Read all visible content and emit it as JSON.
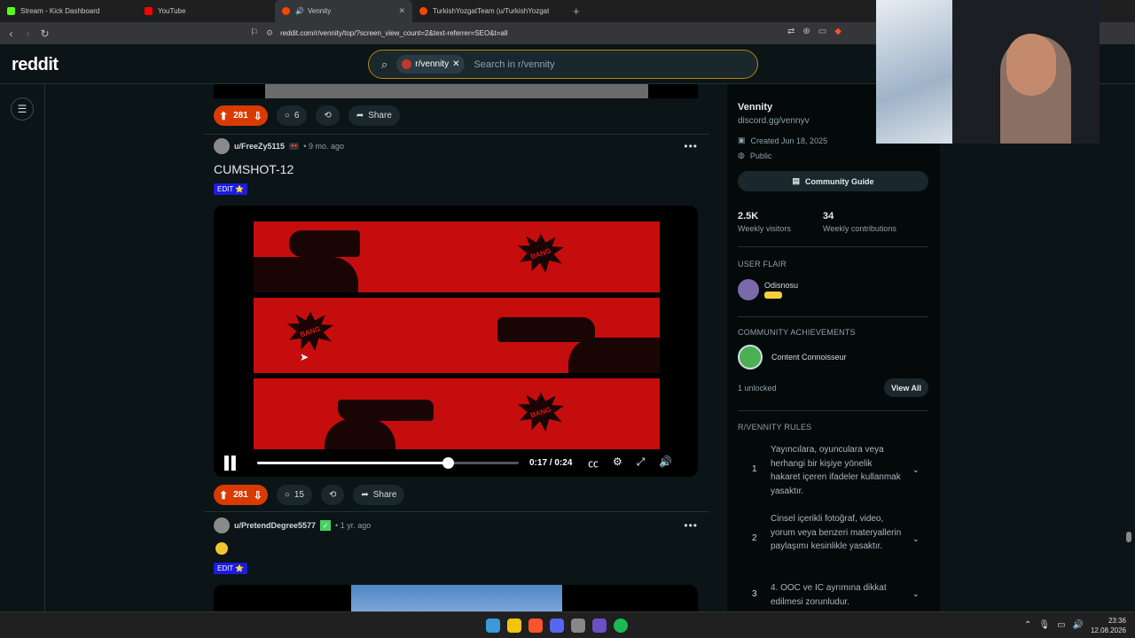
{
  "browser": {
    "tabs": [
      {
        "label": "Stream - Kick Dashboard",
        "color": "#53fc18",
        "active": false
      },
      {
        "label": "YouTube",
        "color": "#ff0000",
        "active": false
      },
      {
        "label": "Vennity",
        "color": "#ff4500",
        "active": true,
        "muted_icon": "speaker-icon"
      },
      {
        "label": "TurkishYozgatTeam (u/TurkishYozgat",
        "color": "#ff4500",
        "active": false
      }
    ],
    "url": "reddit.com/r/vennity/top/?screen_view_count=2&text-referrer=SEO&t=all"
  },
  "header": {
    "logo": "reddit",
    "search_chip": "r/vennity",
    "search_placeholder": "Search in r/vennity"
  },
  "posts": [
    {
      "votes": "281",
      "comments": "6",
      "share": "Share"
    },
    {
      "author": "u/FreeZy5115",
      "time": "• 9 mo. ago",
      "title": "CUMSHOT-12",
      "flair": "EDIT ⭐",
      "video": {
        "current": "0:17",
        "separator": " / ",
        "duration": "0:24",
        "progress": 0.73,
        "bang_text": "BANG"
      },
      "votes": "281",
      "comments": "15",
      "share": "Share"
    },
    {
      "author": "u/PretendDegree5577",
      "time": "• 1 yr. ago",
      "flair": "EDIT ⭐"
    }
  ],
  "sidebar": {
    "name": "Vennity",
    "description": "discord.gg/vennyv",
    "created": "Created Jun 18, 2025",
    "visibility": "Public",
    "guide_button": "Community Guide",
    "stats": [
      {
        "value": "2.5K",
        "label": "Weekly visitors"
      },
      {
        "value": "34",
        "label": "Weekly contributions"
      }
    ],
    "user_flair_heading": "USER FLAIR",
    "user_flair_name": "Odisnosu",
    "achievements_heading": "COMMUNITY ACHIEVEMENTS",
    "achievement": "Content Connoisseur",
    "unlocked": "1 unlocked",
    "view_all": "View All",
    "rules_heading": "R/VENNITY RULES",
    "rules": [
      {
        "n": "1",
        "text": "Yayıncılara, oyunculara veya herhangi bir kişiye yönelik hakaret içeren ifadeler kullanmak yasaktır."
      },
      {
        "n": "2",
        "text": "Cinsel içerikli fotoğraf, video, yorum veya benzeri materyallerin paylaşımı kesinlikle yasaktır."
      },
      {
        "n": "3",
        "text": "4. OOC ve IC ayrımına dikkat edilmesi zorunludur."
      }
    ]
  },
  "taskbar": {
    "time": "23:36",
    "date": "12.08.2026"
  }
}
